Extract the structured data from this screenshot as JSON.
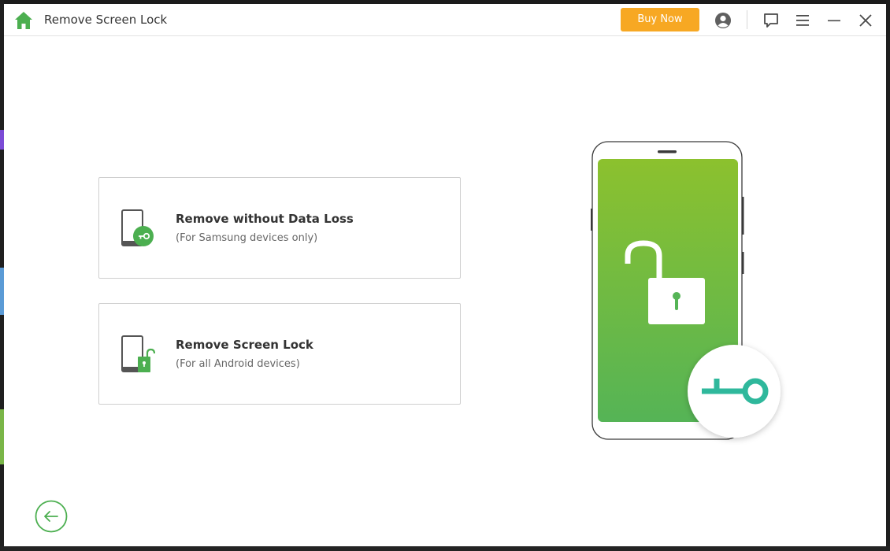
{
  "window": {
    "title": "Remove Screen Lock",
    "buy_label": "Buy Now",
    "accent_color": "#4caf50",
    "buy_color": "#f7a823"
  },
  "toolbar_icons": [
    "account-icon",
    "feedback-icon",
    "menu-icon",
    "minimize-icon",
    "close-icon"
  ],
  "options": [
    {
      "title": "Remove without Data Loss",
      "subtitle": "(For Samsung devices only)",
      "icon": "phone-key-icon"
    },
    {
      "title": "Remove Screen Lock",
      "subtitle": "(For all Android devices)",
      "icon": "phone-unlock-icon"
    }
  ],
  "illustration": {
    "icon": "phone-unlock-illustration",
    "badge_icon": "key-badge-icon"
  },
  "back_icon": "back-arrow-icon"
}
